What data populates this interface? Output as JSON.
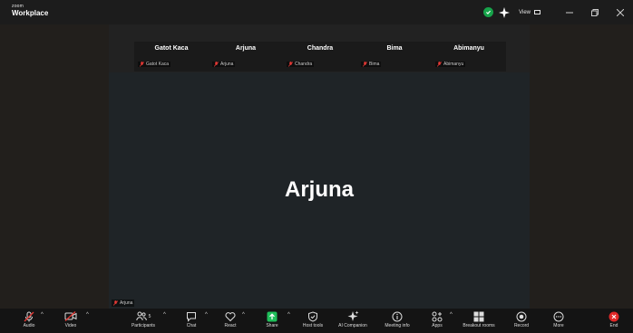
{
  "app": {
    "brand_small": "zoom",
    "brand_title": "Workplace",
    "view_label": "View"
  },
  "strip": {
    "tiles": [
      {
        "name": "Gatot Kaca",
        "tag": "Gatot Kaca"
      },
      {
        "name": "Arjuna",
        "tag": "Arjuna"
      },
      {
        "name": "Chandra",
        "tag": "Chandra"
      },
      {
        "name": "Bima",
        "tag": "Bima"
      },
      {
        "name": "Abimanyu",
        "tag": "Abimanyu"
      }
    ]
  },
  "main": {
    "speaker_name": "Arjuna",
    "speaker_tag": "Arjuna"
  },
  "toolbar": {
    "audio": "Audio",
    "video": "Video",
    "participants": "Participants",
    "participant_count": "5",
    "chat": "Chat",
    "react": "React",
    "share": "Share",
    "host_tools": "Host tools",
    "ai_companion": "AI Companion",
    "meeting_info": "Meeting info",
    "apps": "Apps",
    "breakout_rooms": "Breakout rooms",
    "record": "Record",
    "more": "More",
    "end": "End"
  },
  "colors": {
    "accent_green": "#17a34a",
    "share_green": "#1fbf5a",
    "muted_red": "#e53935",
    "end_red": "#e02828"
  },
  "icons": {
    "mic": "mic-muted-icon",
    "video": "video-off-icon",
    "participants": "people-icon",
    "chat": "chat-bubble-icon",
    "react": "heart-icon",
    "share": "share-arrow-icon",
    "host_tools": "shield-icon",
    "ai_companion": "sparkle-icon",
    "meeting_info": "info-icon",
    "apps": "apps-icon",
    "breakout": "grid-icon",
    "record": "record-icon",
    "more": "ellipsis-icon",
    "end": "close-icon"
  }
}
